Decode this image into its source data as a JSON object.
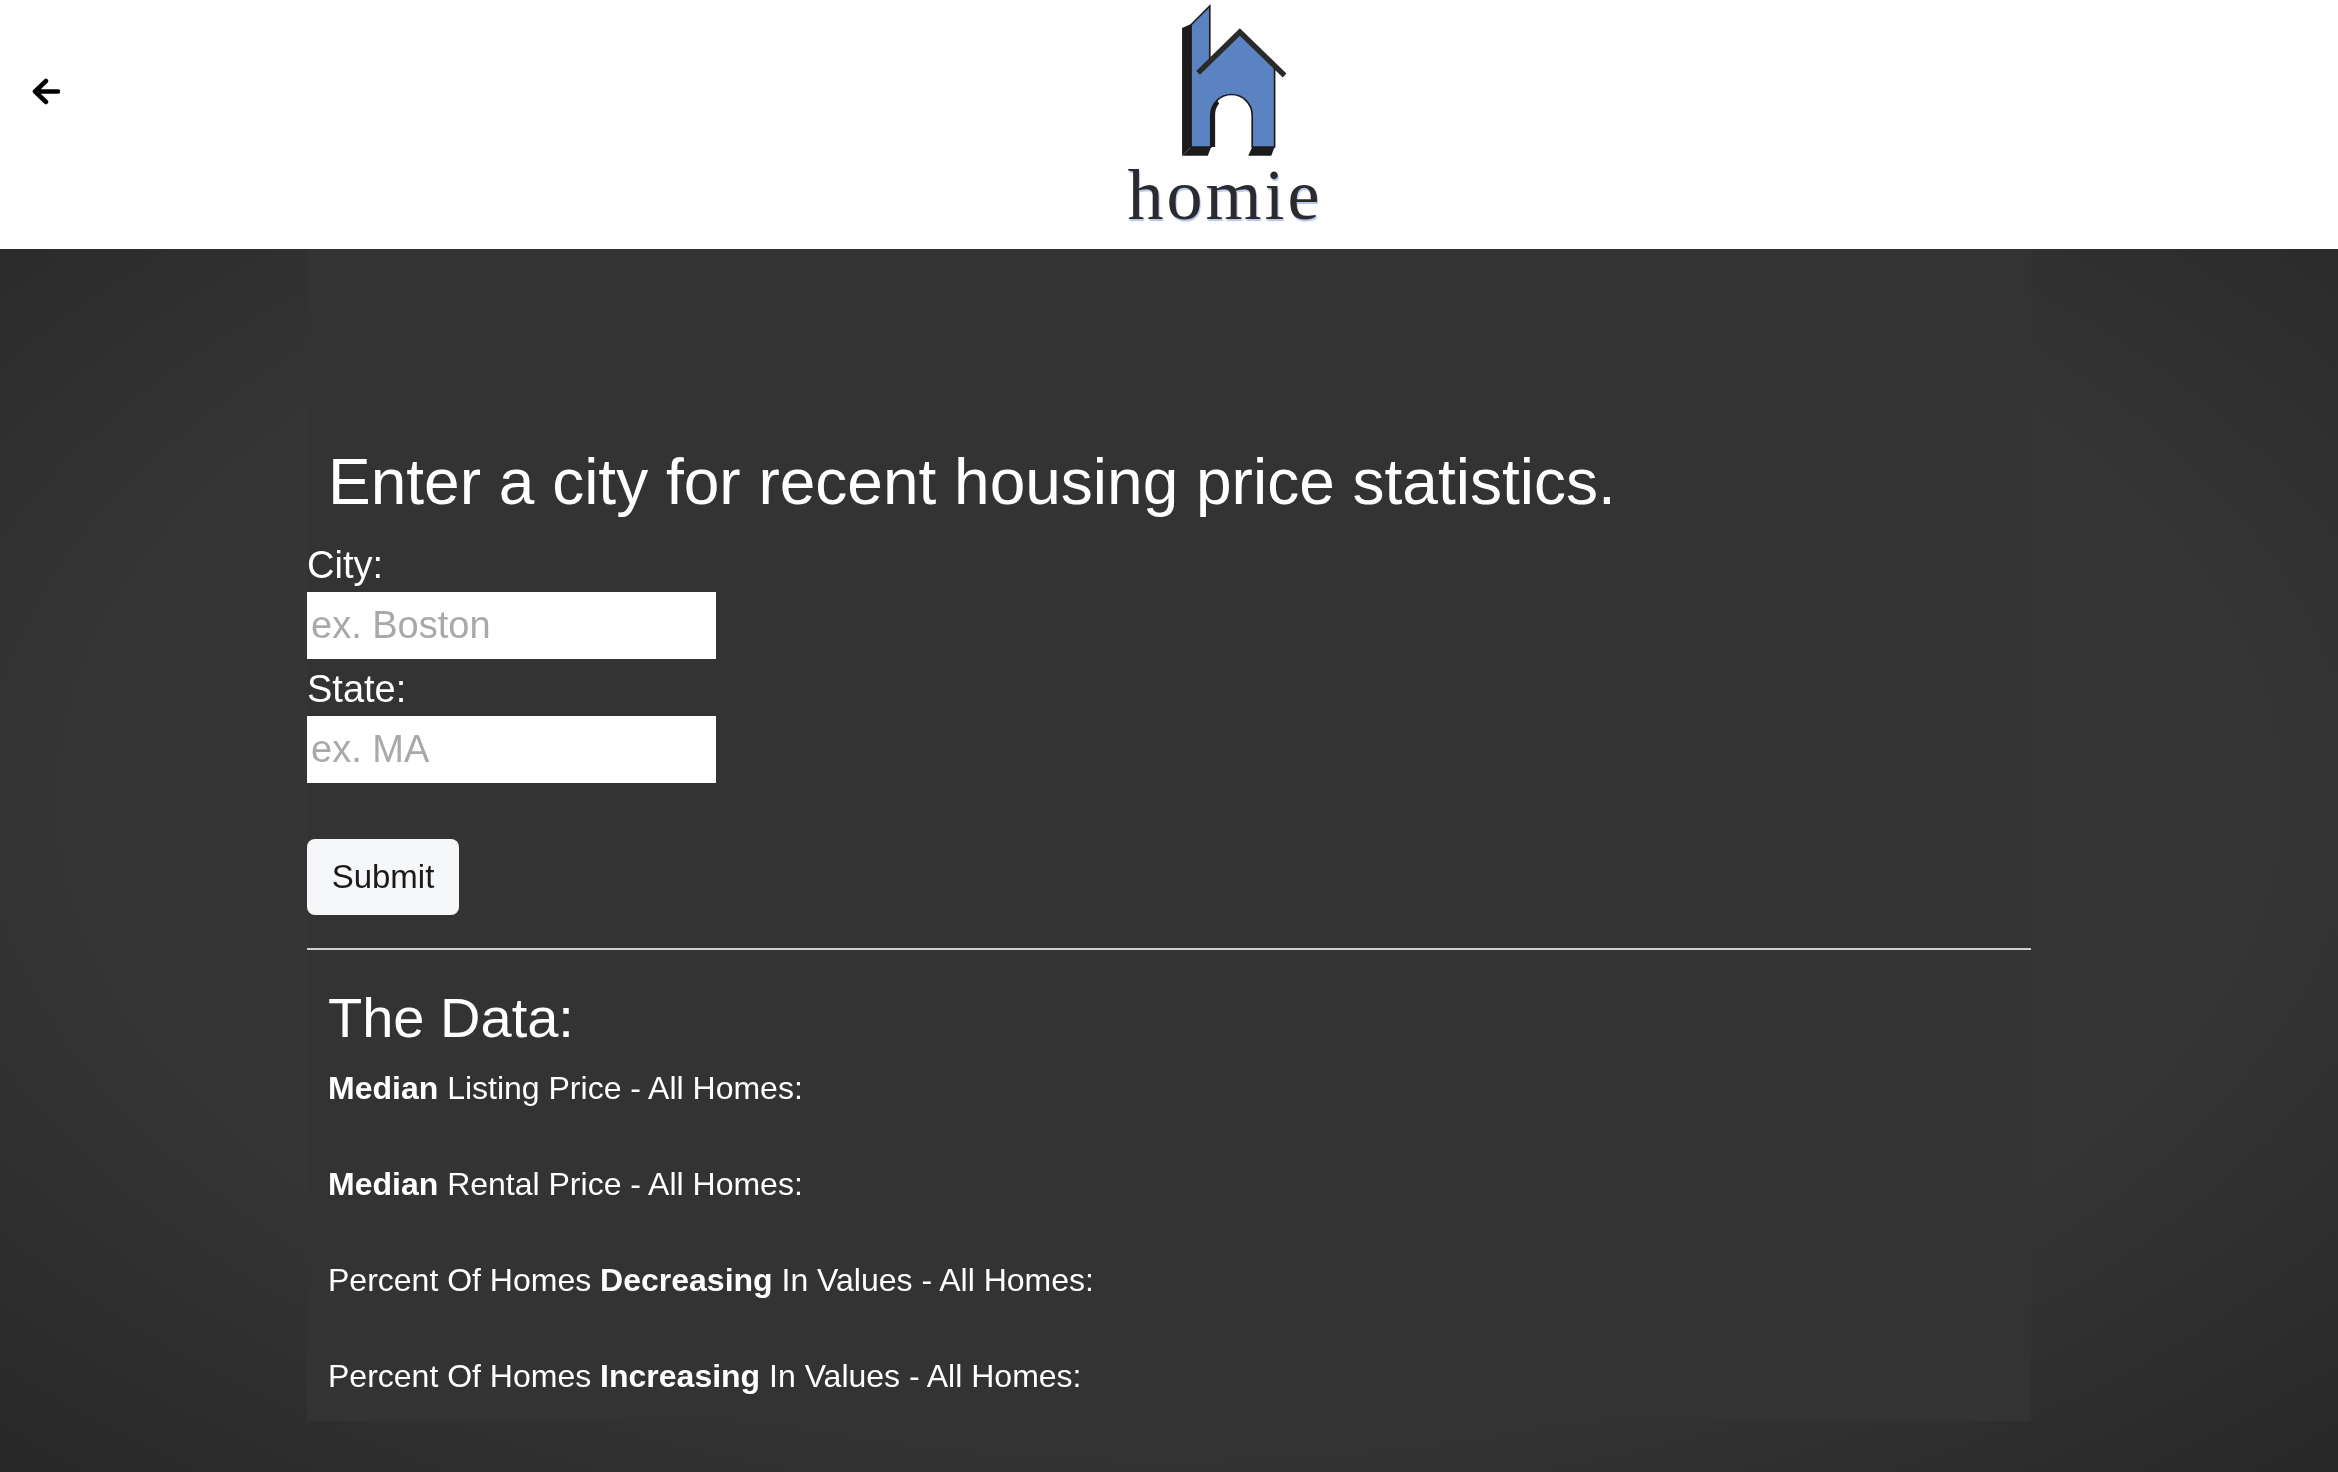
{
  "header": {
    "logo_text": "homie"
  },
  "form": {
    "title": "Enter a city for recent housing price statistics.",
    "fields": [
      {
        "label": "City:",
        "placeholder": "ex. Boston"
      },
      {
        "label": "State:",
        "placeholder": "ex. MA"
      }
    ],
    "submit": "Submit"
  },
  "data": {
    "title": "The Data:",
    "items": [
      "**Median** Listing Price - All Homes:",
      "**Median** Rental Price - All Homes:",
      "Percent Of Homes **Decreasing** In Values - All Homes:",
      "Percent Of Homes **Increasing** In Values - All Homes:"
    ]
  }
}
